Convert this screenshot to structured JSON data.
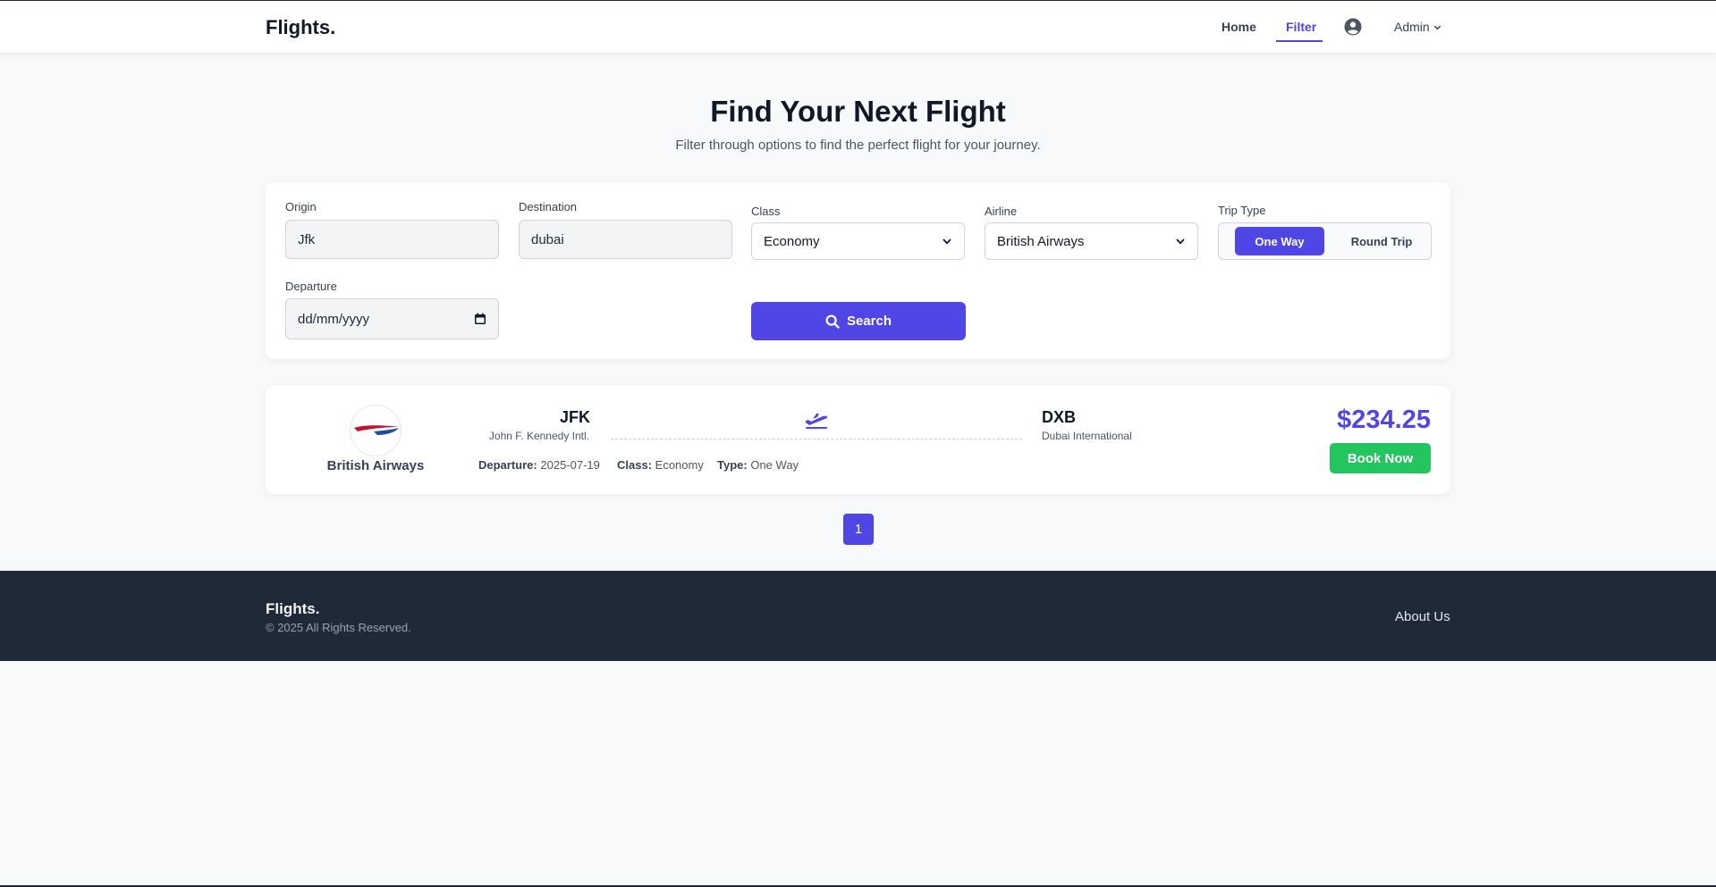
{
  "nav": {
    "brand": "Flights.",
    "home": "Home",
    "filter": "Filter",
    "admin": "Admin",
    "user_icon": "user-circle-icon"
  },
  "hero": {
    "title": "Find Your Next Flight",
    "subtitle": "Filter through options to find the perfect flight for your journey."
  },
  "filters": {
    "origin_label": "Origin",
    "origin_value": "Jfk",
    "destination_label": "Destination",
    "destination_value": "dubai",
    "class_label": "Class",
    "class_value": "Economy",
    "airline_label": "Airline",
    "airline_value": "British Airways",
    "trip_type_label": "Trip Type",
    "trip_one_way": "One Way",
    "trip_round": "Round Trip",
    "trip_selected": "One Way",
    "departure_label": "Departure",
    "departure_placeholder": "dd/mm/yyyy",
    "search_label": "Search"
  },
  "result": {
    "airline": "British Airways",
    "origin_code": "JFK",
    "origin_name": "John F. Kennedy Intl.",
    "destination_code": "DXB",
    "destination_name": "Dubai International",
    "departure_key": "Departure:",
    "departure_value": "2025-07-19",
    "class_key": "Class:",
    "class_value": "Economy",
    "type_key": "Type:",
    "type_value": "One Way",
    "price": "$234.25",
    "book_label": "Book Now"
  },
  "pagination": {
    "current": "1"
  },
  "footer": {
    "brand": "Flights.",
    "copyright": "© 2025 All Rights Reserved.",
    "about": "About Us"
  },
  "colors": {
    "accent": "#4f46e5",
    "success": "#22c55e",
    "footer_bg": "#1f2937"
  }
}
